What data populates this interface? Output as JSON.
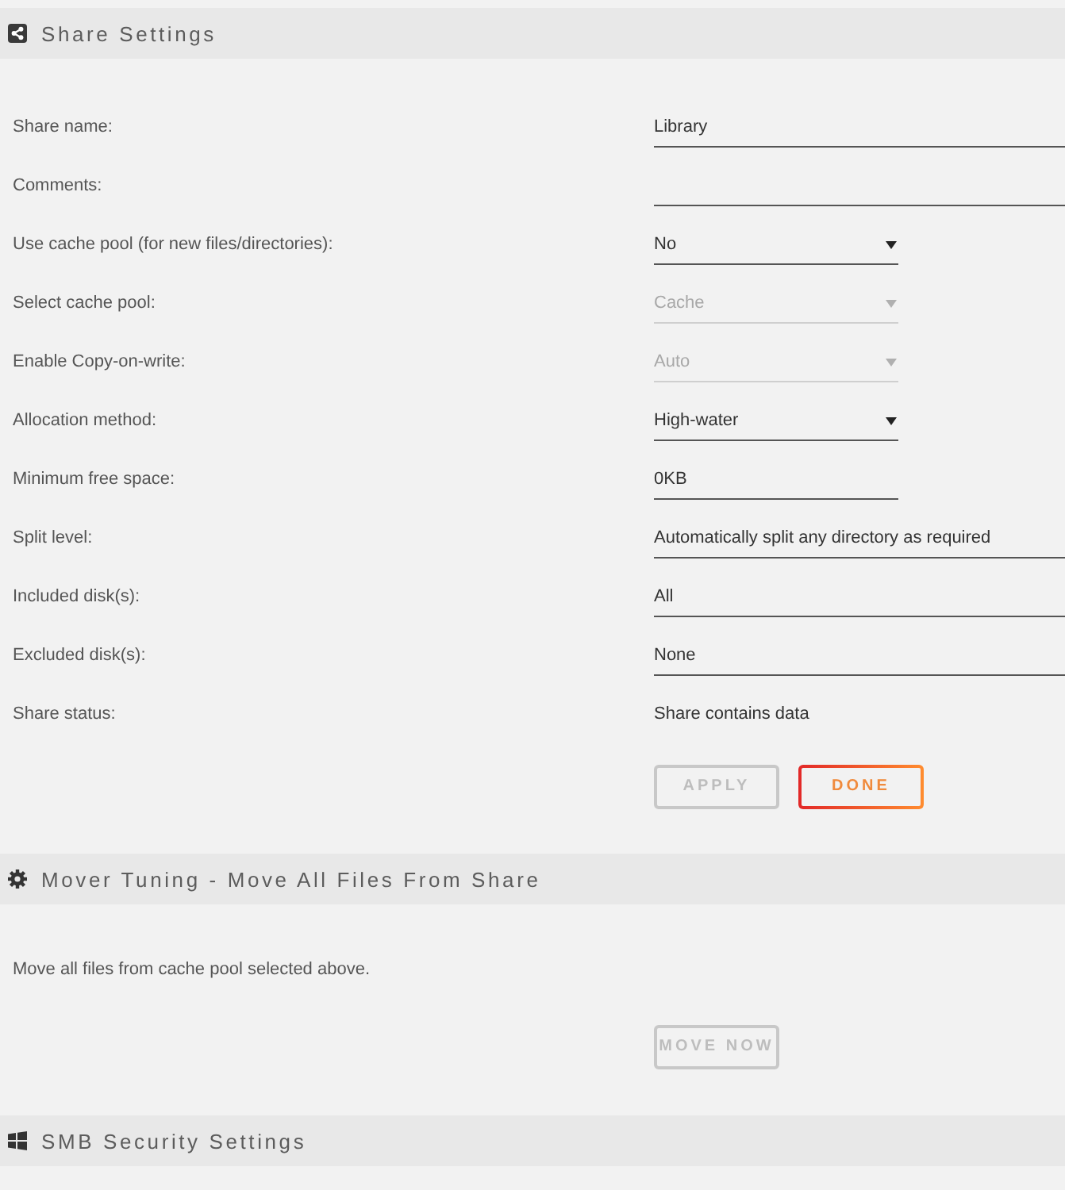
{
  "share_settings": {
    "title": "Share Settings",
    "fields": [
      {
        "label": "Share name:",
        "kind": "text",
        "value": "Library",
        "disabled": false
      },
      {
        "label": "Comments:",
        "kind": "text",
        "disabled": false
      },
      {
        "label": "Use cache pool (for new files/directories):",
        "kind": "select",
        "value": "No",
        "disabled": false
      },
      {
        "label": "Select cache pool:",
        "kind": "select",
        "value": "Cache",
        "disabled": true
      },
      {
        "label": "Enable Copy-on-write:",
        "kind": "select",
        "value": "Auto",
        "disabled": true
      },
      {
        "label": "Allocation method:",
        "kind": "select",
        "value": "High-water",
        "disabled": false
      },
      {
        "label": "Minimum free space:",
        "kind": "size",
        "value": "0KB",
        "disabled": false
      },
      {
        "label": "Split level:",
        "kind": "text",
        "value": "Automatically split any directory as required",
        "disabled": false
      },
      {
        "label": "Included disk(s):",
        "kind": "text",
        "value": "All",
        "disabled": false
      },
      {
        "label": "Excluded disk(s):",
        "kind": "text",
        "value": "None",
        "disabled": false
      },
      {
        "label": "Share status:",
        "kind": "static",
        "value": "Share contains data",
        "disabled": false
      }
    ],
    "buttons": [
      {
        "label": "APPLY",
        "disabled": true
      },
      {
        "label": "DONE",
        "disabled": false
      }
    ]
  },
  "mover_tuning": {
    "title": "Mover Tuning - Move All Files From Share",
    "description": "Move all files from cache pool selected above.",
    "buttons": [
      {
        "label": "MOVE NOW",
        "disabled": true
      }
    ]
  },
  "smb_security": {
    "title": "SMB Security Settings"
  }
}
